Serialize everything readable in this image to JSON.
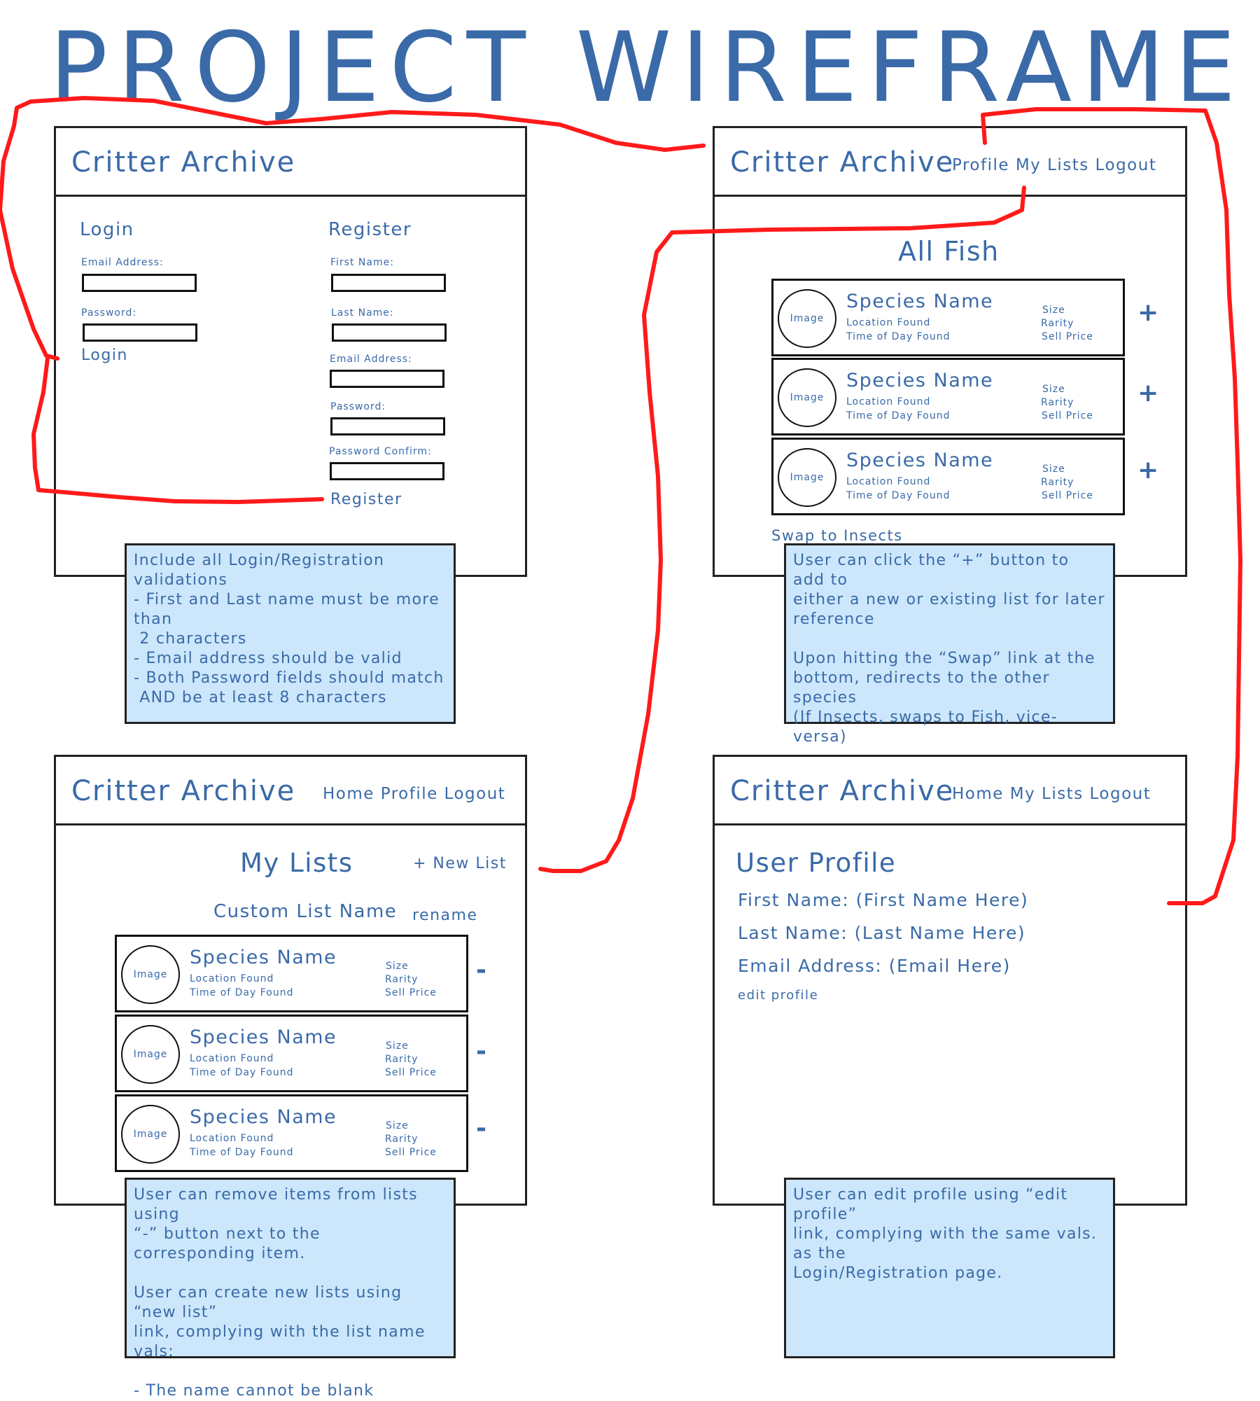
{
  "title": "PROJECT WIREFRAME",
  "colors": {
    "text": "#3a6aa8",
    "note_bg": "#cce7fb",
    "flow_line": "#ff1a1a",
    "border": "#222222"
  },
  "login_screen": {
    "brand": "Critter Archive",
    "login": {
      "heading": "Login",
      "email_label": "Email Address:",
      "password_label": "Password:",
      "submit": "Login"
    },
    "register": {
      "heading": "Register",
      "first_name_label": "First Name:",
      "last_name_label": "Last Name:",
      "email_label": "Email Address:",
      "password_label": "Password:",
      "confirm_label": "Password Confirm:",
      "submit": "Register"
    },
    "note": "Include all Login/Registration validations\n- First and Last name must be more than\n 2 characters\n- Email address should be valid\n- Both Password fields should match\n AND be at least 8 characters"
  },
  "fish_screen": {
    "brand": "Critter Archive",
    "nav": "Profile My Lists Logout",
    "heading": "All Fish",
    "add_symbol": "+",
    "cards": [
      {
        "image": "Image",
        "species": "Species Name",
        "location": "Location Found",
        "time": "Time of Day Found",
        "size": "Size",
        "rarity": "Rarity",
        "price": "Sell Price"
      },
      {
        "image": "Image",
        "species": "Species Name",
        "location": "Location Found",
        "time": "Time of Day Found",
        "size": "Size",
        "rarity": "Rarity",
        "price": "Sell Price"
      },
      {
        "image": "Image",
        "species": "Species Name",
        "location": "Location Found",
        "time": "Time of Day Found",
        "size": "Size",
        "rarity": "Rarity",
        "price": "Sell Price"
      }
    ],
    "swap_link": "Swap to Insects",
    "note": "User can click the “+” button to add to\neither a new or existing list for later\nreference\n\nUpon hitting the “Swap” link at the\nbottom, redirects to the other species\n(If Insects, swaps to Fish, vice-versa)"
  },
  "lists_screen": {
    "brand": "Critter Archive",
    "nav": "Home Profile Logout",
    "heading": "My Lists",
    "new_list": "+ New List",
    "list_name": "Custom List Name",
    "rename": "rename",
    "remove_symbol": "-",
    "cards": [
      {
        "image": "Image",
        "species": "Species Name",
        "location": "Location Found",
        "time": "Time of Day Found",
        "size": "Size",
        "rarity": "Rarity",
        "price": "Sell Price"
      },
      {
        "image": "Image",
        "species": "Species Name",
        "location": "Location Found",
        "time": "Time of Day Found",
        "size": "Size",
        "rarity": "Rarity",
        "price": "Sell Price"
      },
      {
        "image": "Image",
        "species": "Species Name",
        "location": "Location Found",
        "time": "Time of Day Found",
        "size": "Size",
        "rarity": "Rarity",
        "price": "Sell Price"
      }
    ],
    "note": "User can remove items from lists using\n“-” button next to the corresponding item.\n\nUser can create new lists using “new list”\nlink, complying with the list name vals:\n\n- The name cannot be blank"
  },
  "profile_screen": {
    "brand": "Critter Archive",
    "nav": "Home My Lists Logout",
    "heading": "User Profile",
    "first_name": "First Name: (First Name Here)",
    "last_name": "Last Name: (Last Name Here)",
    "email": "Email Address: (Email Here)",
    "edit": "edit profile",
    "note": "User can edit profile using “edit profile”\nlink, complying with the same vals. as the\nLogin/Registration page."
  }
}
